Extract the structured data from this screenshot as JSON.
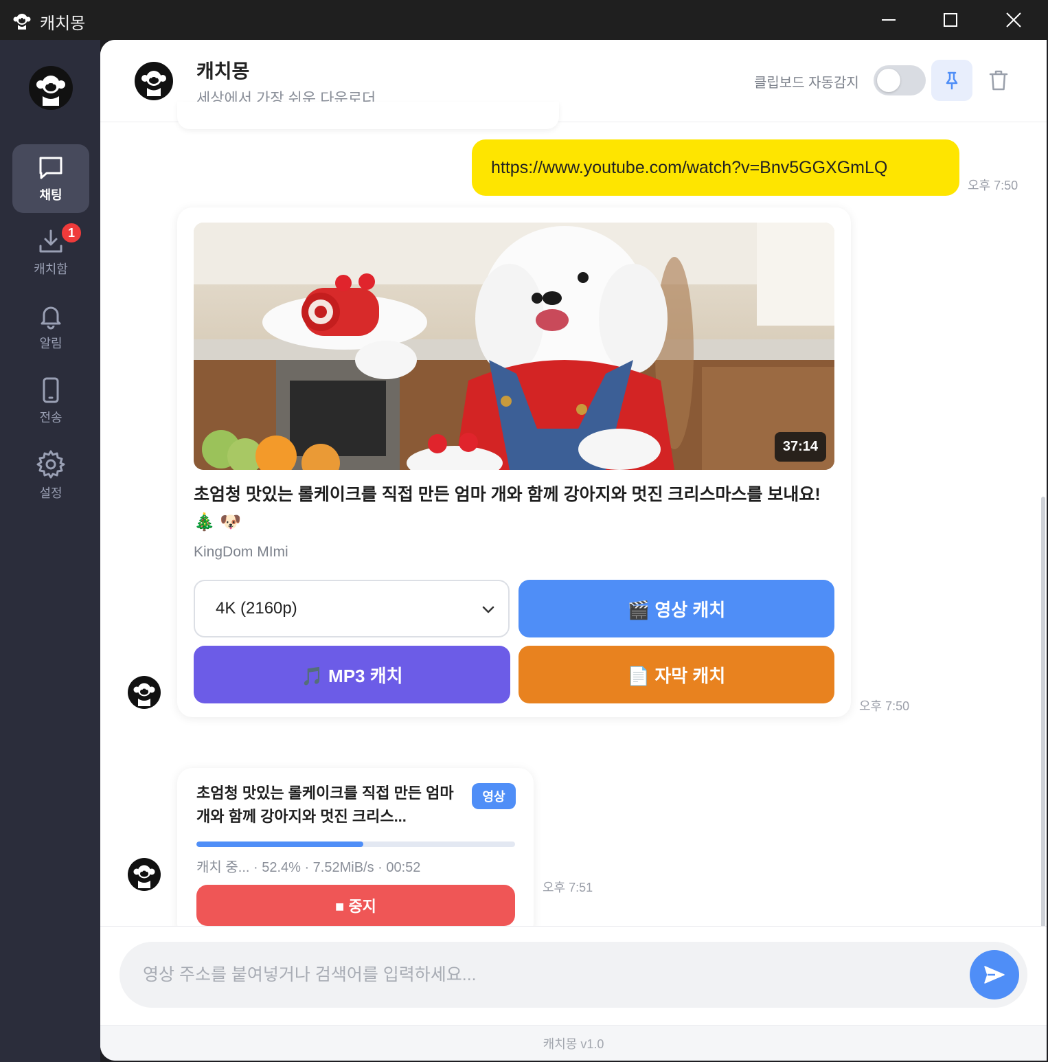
{
  "window": {
    "title": "캐치몽",
    "minimize_icon": "minimize-icon",
    "maximize_icon": "maximize-icon",
    "close_icon": "close-icon"
  },
  "sidebar": {
    "items": [
      {
        "label": "채팅",
        "icon": "chat-icon",
        "active": true
      },
      {
        "label": "캐치함",
        "icon": "download-icon",
        "badge": "1"
      },
      {
        "label": "알림",
        "icon": "bell-icon"
      },
      {
        "label": "전송",
        "icon": "phone-icon"
      },
      {
        "label": "설정",
        "icon": "gear-icon"
      }
    ]
  },
  "header": {
    "title": "캐치몽",
    "subtitle": "세상에서 가장 쉬운 다운로더",
    "clipboard_label": "클립보드 자동감지",
    "clipboard_enabled": false
  },
  "messages": {
    "url": {
      "text": "https://www.youtube.com/watch?v=Bnv5GGXGmLQ",
      "time": "오후 7:50"
    },
    "video_card": {
      "duration": "37:14",
      "title": "초엄청 맛있는 롤케이크를 직접 만든 엄마 개와 함께 강아지와 멋진 크리스마스를 보내요! 🎄 🐶",
      "channel": "KingDom MImi",
      "quality": "4K (2160p)",
      "video_button": "🎬 영상 캐치",
      "mp3_button": "🎵 MP3 캐치",
      "subtitle_button": "📄 자막 캐치",
      "time": "오후 7:50"
    },
    "progress_card": {
      "title": "초엄청 맛있는 롤케이크를 직접 만든 엄마 개와 함께 강아지와 멋진 크리스...",
      "badge": "영상",
      "progress": 0.524,
      "status": "캐치 중... · 52.4% · 7.52MiB/s · 00:52",
      "stop_button": "■ 중지",
      "time": "오후 7:51"
    }
  },
  "composer": {
    "placeholder": "영상 주소를 붙여넣거나 검색어를 입력하세요...",
    "send_icon": "send-icon"
  },
  "footer": {
    "version": "캐치몽 v1.0"
  },
  "colors": {
    "accent": "#4f8ef7",
    "url_bubble": "#fee500",
    "mp3": "#6c5ce7",
    "subtitle": "#e8821f",
    "stop": "#ef5656",
    "sidebar": "#2b2d3b"
  }
}
